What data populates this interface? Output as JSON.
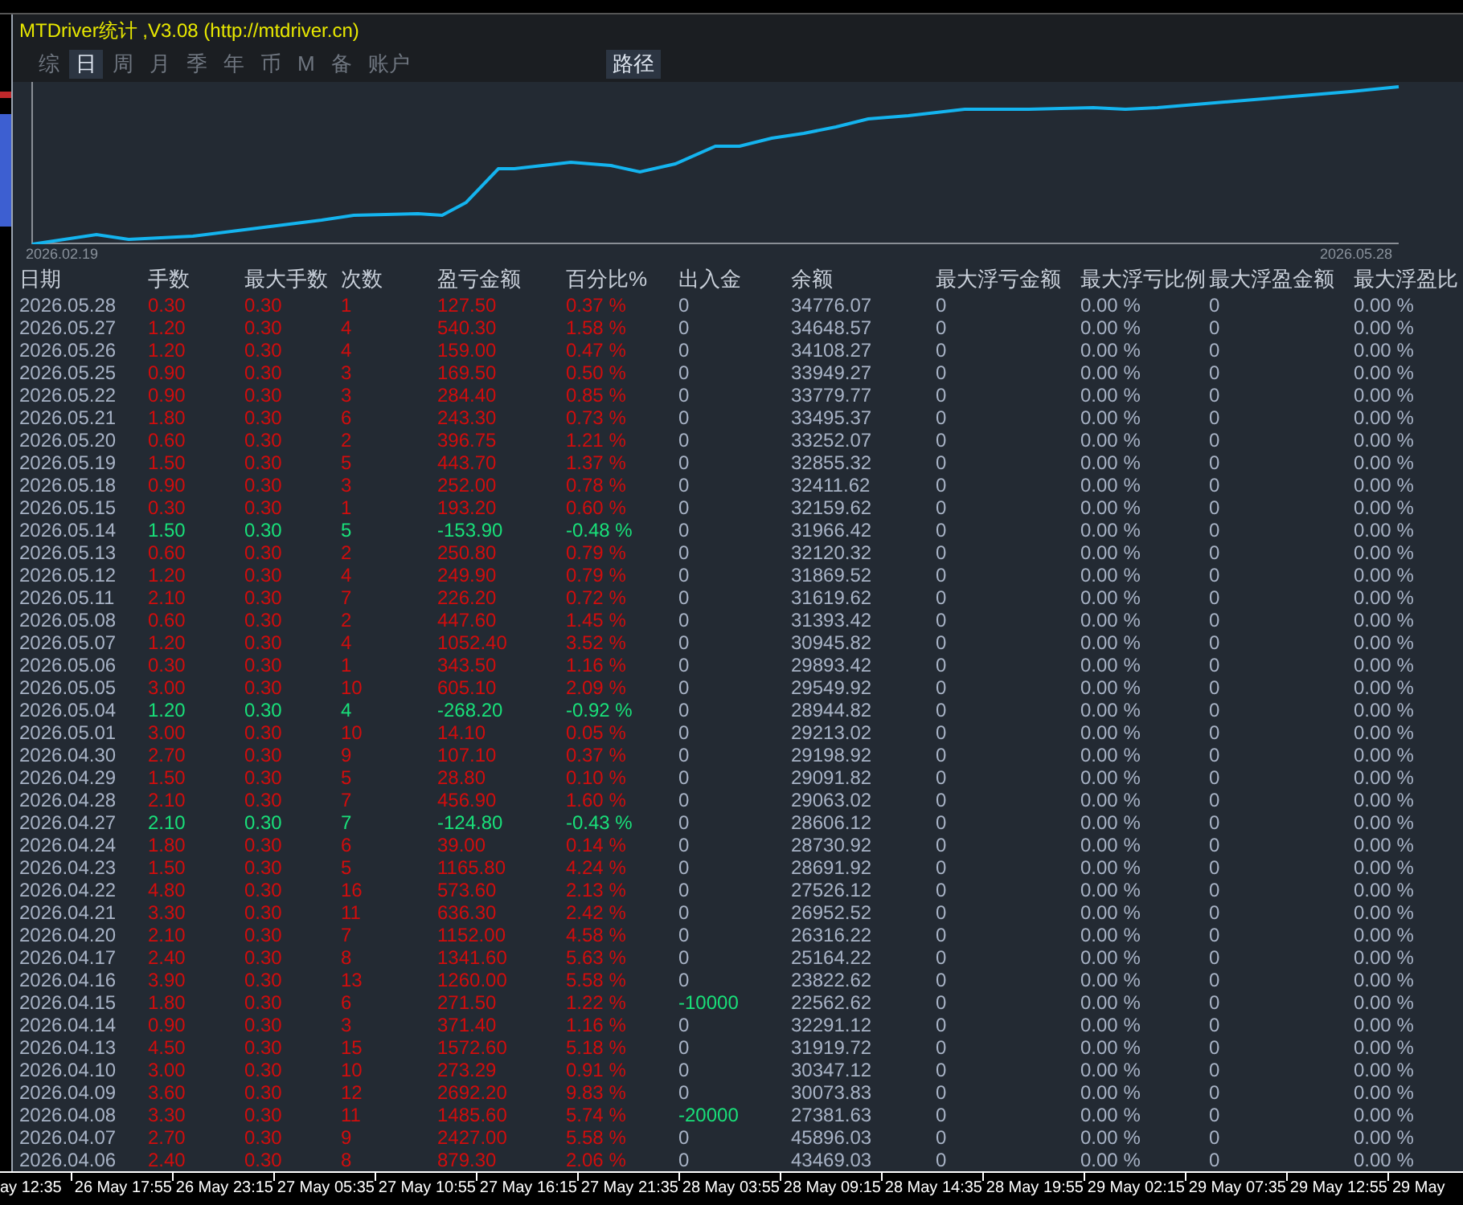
{
  "window": {
    "title": "MTDriver统计 ,V3.08 (http://mtdriver.cn)"
  },
  "tabs": [
    {
      "label": "综",
      "selected": false
    },
    {
      "label": "日",
      "selected": true
    },
    {
      "label": "周",
      "selected": false
    },
    {
      "label": "月",
      "selected": false
    },
    {
      "label": "季",
      "selected": false
    },
    {
      "label": "年",
      "selected": false
    },
    {
      "label": "币",
      "selected": false
    },
    {
      "label": "M",
      "selected": false
    },
    {
      "label": "备",
      "selected": false
    },
    {
      "label": "账户",
      "selected": false
    }
  ],
  "path_button": "路径",
  "equity_chart": {
    "start_label": "2026.02.19",
    "end_label": "2026.05.28"
  },
  "table": {
    "columns": [
      "日期",
      "手数",
      "最大手数",
      "次数",
      "盈亏金额",
      "百分比%",
      "出入金",
      "余额",
      "最大浮亏金额",
      "最大浮亏比例",
      "最大浮盈金额",
      "最大浮盈比"
    ],
    "rows": [
      {
        "kind": "gain",
        "withdrawal": false,
        "cells": [
          "2026.05.28",
          "0.30",
          "0.30",
          "1",
          "127.50",
          "0.37 %",
          "0",
          "34776.07",
          "0",
          "0.00 %",
          "0",
          "0.00 %"
        ]
      },
      {
        "kind": "gain",
        "withdrawal": false,
        "cells": [
          "2026.05.27",
          "1.20",
          "0.30",
          "4",
          "540.30",
          "1.58 %",
          "0",
          "34648.57",
          "0",
          "0.00 %",
          "0",
          "0.00 %"
        ]
      },
      {
        "kind": "gain",
        "withdrawal": false,
        "cells": [
          "2026.05.26",
          "1.20",
          "0.30",
          "4",
          "159.00",
          "0.47 %",
          "0",
          "34108.27",
          "0",
          "0.00 %",
          "0",
          "0.00 %"
        ]
      },
      {
        "kind": "gain",
        "withdrawal": false,
        "cells": [
          "2026.05.25",
          "0.90",
          "0.30",
          "3",
          "169.50",
          "0.50 %",
          "0",
          "33949.27",
          "0",
          "0.00 %",
          "0",
          "0.00 %"
        ]
      },
      {
        "kind": "gain",
        "withdrawal": false,
        "cells": [
          "2026.05.22",
          "0.90",
          "0.30",
          "3",
          "284.40",
          "0.85 %",
          "0",
          "33779.77",
          "0",
          "0.00 %",
          "0",
          "0.00 %"
        ]
      },
      {
        "kind": "gain",
        "withdrawal": false,
        "cells": [
          "2026.05.21",
          "1.80",
          "0.30",
          "6",
          "243.30",
          "0.73 %",
          "0",
          "33495.37",
          "0",
          "0.00 %",
          "0",
          "0.00 %"
        ]
      },
      {
        "kind": "gain",
        "withdrawal": false,
        "cells": [
          "2026.05.20",
          "0.60",
          "0.30",
          "2",
          "396.75",
          "1.21 %",
          "0",
          "33252.07",
          "0",
          "0.00 %",
          "0",
          "0.00 %"
        ]
      },
      {
        "kind": "gain",
        "withdrawal": false,
        "cells": [
          "2026.05.19",
          "1.50",
          "0.30",
          "5",
          "443.70",
          "1.37 %",
          "0",
          "32855.32",
          "0",
          "0.00 %",
          "0",
          "0.00 %"
        ]
      },
      {
        "kind": "gain",
        "withdrawal": false,
        "cells": [
          "2026.05.18",
          "0.90",
          "0.30",
          "3",
          "252.00",
          "0.78 %",
          "0",
          "32411.62",
          "0",
          "0.00 %",
          "0",
          "0.00 %"
        ]
      },
      {
        "kind": "gain",
        "withdrawal": false,
        "cells": [
          "2026.05.15",
          "0.30",
          "0.30",
          "1",
          "193.20",
          "0.60 %",
          "0",
          "32159.62",
          "0",
          "0.00 %",
          "0",
          "0.00 %"
        ]
      },
      {
        "kind": "loss",
        "withdrawal": false,
        "cells": [
          "2026.05.14",
          "1.50",
          "0.30",
          "5",
          "-153.90",
          "-0.48 %",
          "0",
          "31966.42",
          "0",
          "0.00 %",
          "0",
          "0.00 %"
        ]
      },
      {
        "kind": "gain",
        "withdrawal": false,
        "cells": [
          "2026.05.13",
          "0.60",
          "0.30",
          "2",
          "250.80",
          "0.79 %",
          "0",
          "32120.32",
          "0",
          "0.00 %",
          "0",
          "0.00 %"
        ]
      },
      {
        "kind": "gain",
        "withdrawal": false,
        "cells": [
          "2026.05.12",
          "1.20",
          "0.30",
          "4",
          "249.90",
          "0.79 %",
          "0",
          "31869.52",
          "0",
          "0.00 %",
          "0",
          "0.00 %"
        ]
      },
      {
        "kind": "gain",
        "withdrawal": false,
        "cells": [
          "2026.05.11",
          "2.10",
          "0.30",
          "7",
          "226.20",
          "0.72 %",
          "0",
          "31619.62",
          "0",
          "0.00 %",
          "0",
          "0.00 %"
        ]
      },
      {
        "kind": "gain",
        "withdrawal": false,
        "cells": [
          "2026.05.08",
          "0.60",
          "0.30",
          "2",
          "447.60",
          "1.45 %",
          "0",
          "31393.42",
          "0",
          "0.00 %",
          "0",
          "0.00 %"
        ]
      },
      {
        "kind": "gain",
        "withdrawal": false,
        "cells": [
          "2026.05.07",
          "1.20",
          "0.30",
          "4",
          "1052.40",
          "3.52 %",
          "0",
          "30945.82",
          "0",
          "0.00 %",
          "0",
          "0.00 %"
        ]
      },
      {
        "kind": "gain",
        "withdrawal": false,
        "cells": [
          "2026.05.06",
          "0.30",
          "0.30",
          "1",
          "343.50",
          "1.16 %",
          "0",
          "29893.42",
          "0",
          "0.00 %",
          "0",
          "0.00 %"
        ]
      },
      {
        "kind": "gain",
        "withdrawal": false,
        "cells": [
          "2026.05.05",
          "3.00",
          "0.30",
          "10",
          "605.10",
          "2.09 %",
          "0",
          "29549.92",
          "0",
          "0.00 %",
          "0",
          "0.00 %"
        ]
      },
      {
        "kind": "loss",
        "withdrawal": false,
        "cells": [
          "2026.05.04",
          "1.20",
          "0.30",
          "4",
          "-268.20",
          "-0.92 %",
          "0",
          "28944.82",
          "0",
          "0.00 %",
          "0",
          "0.00 %"
        ]
      },
      {
        "kind": "gain",
        "withdrawal": false,
        "cells": [
          "2026.05.01",
          "3.00",
          "0.30",
          "10",
          "14.10",
          "0.05 %",
          "0",
          "29213.02",
          "0",
          "0.00 %",
          "0",
          "0.00 %"
        ]
      },
      {
        "kind": "gain",
        "withdrawal": false,
        "cells": [
          "2026.04.30",
          "2.70",
          "0.30",
          "9",
          "107.10",
          "0.37 %",
          "0",
          "29198.92",
          "0",
          "0.00 %",
          "0",
          "0.00 %"
        ]
      },
      {
        "kind": "gain",
        "withdrawal": false,
        "cells": [
          "2026.04.29",
          "1.50",
          "0.30",
          "5",
          "28.80",
          "0.10 %",
          "0",
          "29091.82",
          "0",
          "0.00 %",
          "0",
          "0.00 %"
        ]
      },
      {
        "kind": "gain",
        "withdrawal": false,
        "cells": [
          "2026.04.28",
          "2.10",
          "0.30",
          "7",
          "456.90",
          "1.60 %",
          "0",
          "29063.02",
          "0",
          "0.00 %",
          "0",
          "0.00 %"
        ]
      },
      {
        "kind": "loss",
        "withdrawal": false,
        "cells": [
          "2026.04.27",
          "2.10",
          "0.30",
          "7",
          "-124.80",
          "-0.43 %",
          "0",
          "28606.12",
          "0",
          "0.00 %",
          "0",
          "0.00 %"
        ]
      },
      {
        "kind": "gain",
        "withdrawal": false,
        "cells": [
          "2026.04.24",
          "1.80",
          "0.30",
          "6",
          "39.00",
          "0.14 %",
          "0",
          "28730.92",
          "0",
          "0.00 %",
          "0",
          "0.00 %"
        ]
      },
      {
        "kind": "gain",
        "withdrawal": false,
        "cells": [
          "2026.04.23",
          "1.50",
          "0.30",
          "5",
          "1165.80",
          "4.24 %",
          "0",
          "28691.92",
          "0",
          "0.00 %",
          "0",
          "0.00 %"
        ]
      },
      {
        "kind": "gain",
        "withdrawal": false,
        "cells": [
          "2026.04.22",
          "4.80",
          "0.30",
          "16",
          "573.60",
          "2.13 %",
          "0",
          "27526.12",
          "0",
          "0.00 %",
          "0",
          "0.00 %"
        ]
      },
      {
        "kind": "gain",
        "withdrawal": false,
        "cells": [
          "2026.04.21",
          "3.30",
          "0.30",
          "11",
          "636.30",
          "2.42 %",
          "0",
          "26952.52",
          "0",
          "0.00 %",
          "0",
          "0.00 %"
        ]
      },
      {
        "kind": "gain",
        "withdrawal": false,
        "cells": [
          "2026.04.20",
          "2.10",
          "0.30",
          "7",
          "1152.00",
          "4.58 %",
          "0",
          "26316.22",
          "0",
          "0.00 %",
          "0",
          "0.00 %"
        ]
      },
      {
        "kind": "gain",
        "withdrawal": false,
        "cells": [
          "2026.04.17",
          "2.40",
          "0.30",
          "8",
          "1341.60",
          "5.63 %",
          "0",
          "25164.22",
          "0",
          "0.00 %",
          "0",
          "0.00 %"
        ]
      },
      {
        "kind": "gain",
        "withdrawal": false,
        "cells": [
          "2026.04.16",
          "3.90",
          "0.30",
          "13",
          "1260.00",
          "5.58 %",
          "0",
          "23822.62",
          "0",
          "0.00 %",
          "0",
          "0.00 %"
        ]
      },
      {
        "kind": "gain",
        "withdrawal": true,
        "cells": [
          "2026.04.15",
          "1.80",
          "0.30",
          "6",
          "271.50",
          "1.22 %",
          "-10000",
          "22562.62",
          "0",
          "0.00 %",
          "0",
          "0.00 %"
        ]
      },
      {
        "kind": "gain",
        "withdrawal": false,
        "cells": [
          "2026.04.14",
          "0.90",
          "0.30",
          "3",
          "371.40",
          "1.16 %",
          "0",
          "32291.12",
          "0",
          "0.00 %",
          "0",
          "0.00 %"
        ]
      },
      {
        "kind": "gain",
        "withdrawal": false,
        "cells": [
          "2026.04.13",
          "4.50",
          "0.30",
          "15",
          "1572.60",
          "5.18 %",
          "0",
          "31919.72",
          "0",
          "0.00 %",
          "0",
          "0.00 %"
        ]
      },
      {
        "kind": "gain",
        "withdrawal": false,
        "cells": [
          "2026.04.10",
          "3.00",
          "0.30",
          "10",
          "273.29",
          "0.91 %",
          "0",
          "30347.12",
          "0",
          "0.00 %",
          "0",
          "0.00 %"
        ]
      },
      {
        "kind": "gain",
        "withdrawal": false,
        "cells": [
          "2026.04.09",
          "3.60",
          "0.30",
          "12",
          "2692.20",
          "9.83 %",
          "0",
          "30073.83",
          "0",
          "0.00 %",
          "0",
          "0.00 %"
        ]
      },
      {
        "kind": "gain",
        "withdrawal": true,
        "cells": [
          "2026.04.08",
          "3.30",
          "0.30",
          "11",
          "1485.60",
          "5.74 %",
          "-20000",
          "27381.63",
          "0",
          "0.00 %",
          "0",
          "0.00 %"
        ]
      },
      {
        "kind": "gain",
        "withdrawal": false,
        "cells": [
          "2026.04.07",
          "2.70",
          "0.30",
          "9",
          "2427.00",
          "5.58 %",
          "0",
          "45896.03",
          "0",
          "0.00 %",
          "0",
          "0.00 %"
        ]
      },
      {
        "kind": "gain",
        "withdrawal": false,
        "cells": [
          "2026.04.06",
          "2.40",
          "0.30",
          "8",
          "879.30",
          "2.06 %",
          "0",
          "43469.03",
          "0",
          "0.00 %",
          "0",
          "0.00 %"
        ]
      }
    ]
  },
  "time_axis": [
    "ay 12:35",
    "26 May 17:55",
    "26 May 23:15",
    "27 May 05:35",
    "27 May 10:55",
    "27 May 16:15",
    "27 May 21:35",
    "28 May 03:55",
    "28 May 09:15",
    "28 May 14:35",
    "28 May 19:55",
    "29 May 02:15",
    "29 May 07:35",
    "29 May 12:55",
    "29 May"
  ]
}
